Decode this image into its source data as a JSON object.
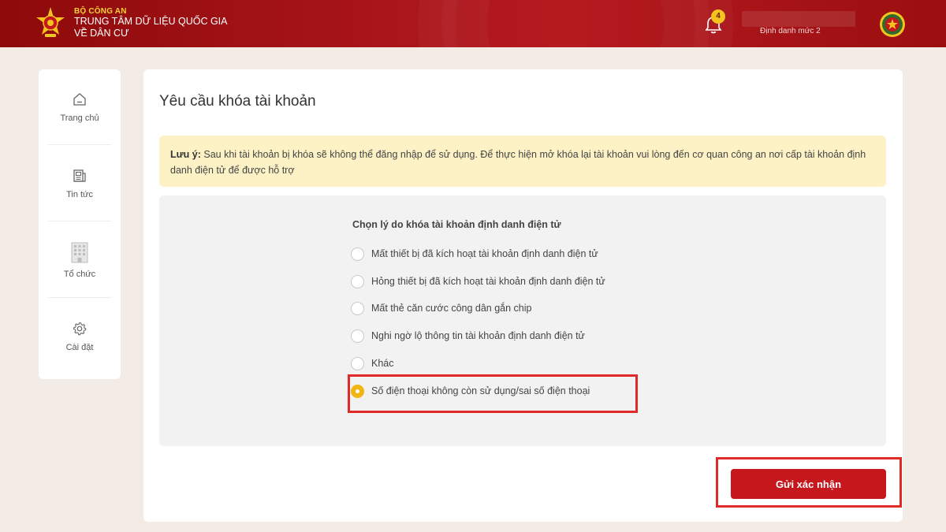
{
  "header": {
    "org_top": "BỘ CÔNG AN",
    "org_line1": "TRUNG TÂM DỮ LIỆU QUỐC GIA",
    "org_line2": "VỀ DÂN CƯ",
    "notification_count": "4",
    "user_level": "Định danh mức 2",
    "icons": {
      "logo": "police-emblem",
      "bell": "bell-icon",
      "avatar": "police-badge-avatar"
    },
    "colors": {
      "header_bg": "#a8151a",
      "accent_yellow": "#f5d23a"
    }
  },
  "sidebar": {
    "items": [
      {
        "label": "Trang chủ",
        "icon": "home-icon"
      },
      {
        "label": "Tin tức",
        "icon": "news-icon"
      },
      {
        "label": "Tổ chức",
        "icon": "building-icon"
      },
      {
        "label": "Cài đặt",
        "icon": "gear-icon"
      }
    ]
  },
  "main": {
    "title": "Yêu cầu khóa tài khoản",
    "notice": {
      "label": "Lưu ý:",
      "text": " Sau khi tài khoản bị khóa sẽ không thể đăng nhập để sử dụng. Để thực hiện mở khóa lại tài khoản vui lòng đến cơ quan công an nơi cấp tài khoản định danh điện tử để được hỗ trợ"
    },
    "question": "Chọn lý do khóa tài khoản định danh điện tử",
    "options": [
      {
        "label": "Mất thiết bị đã kích hoạt tài khoản định danh điện tử",
        "selected": false
      },
      {
        "label": "Hỏng thiết bị đã kích hoạt tài khoản định danh điện tử",
        "selected": false
      },
      {
        "label": "Mất thẻ căn cước công dân gắn chip",
        "selected": false
      },
      {
        "label": "Nghi ngờ lộ thông tin tài khoản định danh điện tử",
        "selected": false
      },
      {
        "label": "Khác",
        "selected": false
      },
      {
        "label": "Số điện thoại không còn sử dụng/sai số điện thoại",
        "selected": true
      }
    ],
    "submit_label": "Gửi xác nhận",
    "colors": {
      "submit_bg": "#c6171c",
      "radio_selected": "#f2b614",
      "highlight_border": "#e02a2a",
      "notice_bg": "#fdf2c5"
    }
  }
}
